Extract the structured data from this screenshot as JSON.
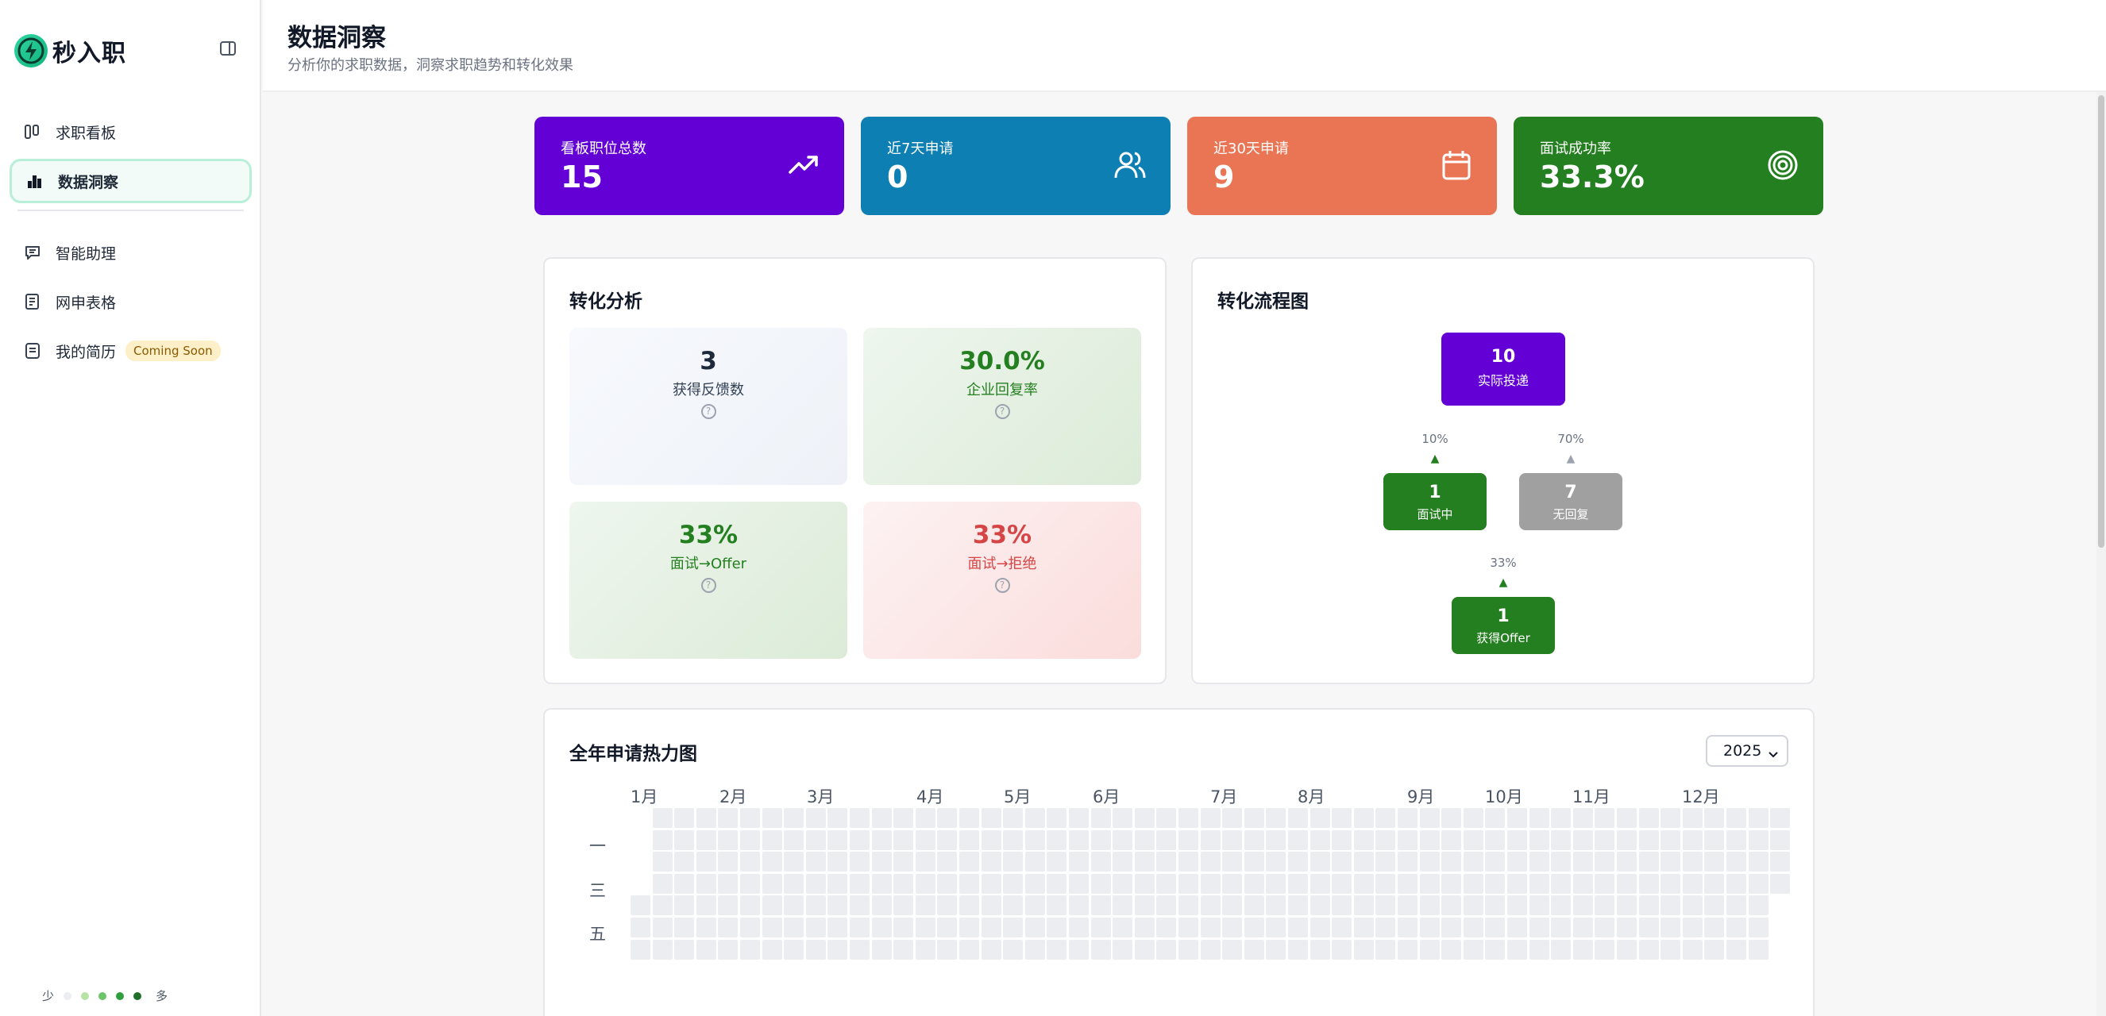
{
  "sidebar": {
    "logo_text": "秒入职",
    "items": [
      {
        "label": "求职看板"
      },
      {
        "label": "数据洞察"
      },
      {
        "label": "智能助理"
      },
      {
        "label": "网申表格"
      },
      {
        "label": "我的简历",
        "badge": "Coming Soon"
      }
    ]
  },
  "header": {
    "title": "数据洞察",
    "subtitle": "分析你的求职数据，洞察求职趋势和转化效果"
  },
  "stats": [
    {
      "label": "看板职位总数",
      "value": "15",
      "color": "#6200d5",
      "icon": "trending-up-icon"
    },
    {
      "label": "近7天申请",
      "value": "0",
      "color": "#0d7fb2",
      "icon": "users-icon"
    },
    {
      "label": "近30天申请",
      "value": "9",
      "color": "#e97555",
      "icon": "calendar-icon"
    },
    {
      "label": "面试成功率",
      "value": "33.3%",
      "color": "#237f1f",
      "icon": "target-icon"
    }
  ],
  "conversion": {
    "title": "转化分析",
    "metrics": [
      {
        "value": "3",
        "label": "获得反馈数"
      },
      {
        "value": "30.0%",
        "label": "企业回复率"
      },
      {
        "value": "33%",
        "label": "面试→Offer"
      },
      {
        "value": "33%",
        "label": "面试→拒绝"
      }
    ],
    "help_glyph": "?"
  },
  "funnel": {
    "title": "转化流程图",
    "applied": {
      "value": "10",
      "label": "实际投递"
    },
    "interview": {
      "value": "1",
      "label": "面试中",
      "rate": "10%"
    },
    "no_reply": {
      "value": "7",
      "label": "无回复",
      "rate": "70%"
    },
    "offer": {
      "value": "1",
      "label": "获得Offer",
      "rate": "33%"
    },
    "arrow_glyph": "▲"
  },
  "heatmap": {
    "title": "全年申请热力图",
    "year": "2025",
    "months": [
      "1月",
      "2月",
      "3月",
      "4月",
      "5月",
      "6月",
      "7月",
      "8月",
      "9月",
      "10月",
      "11月",
      "12月"
    ],
    "weekdays": [
      "一",
      "三",
      "五"
    ],
    "legend_less": "少",
    "legend_more": "多",
    "legend_colors": [
      "#ebedf0",
      "#b6e3a3",
      "#6cc46b",
      "#2e9e3e",
      "#1f6f2a"
    ]
  }
}
